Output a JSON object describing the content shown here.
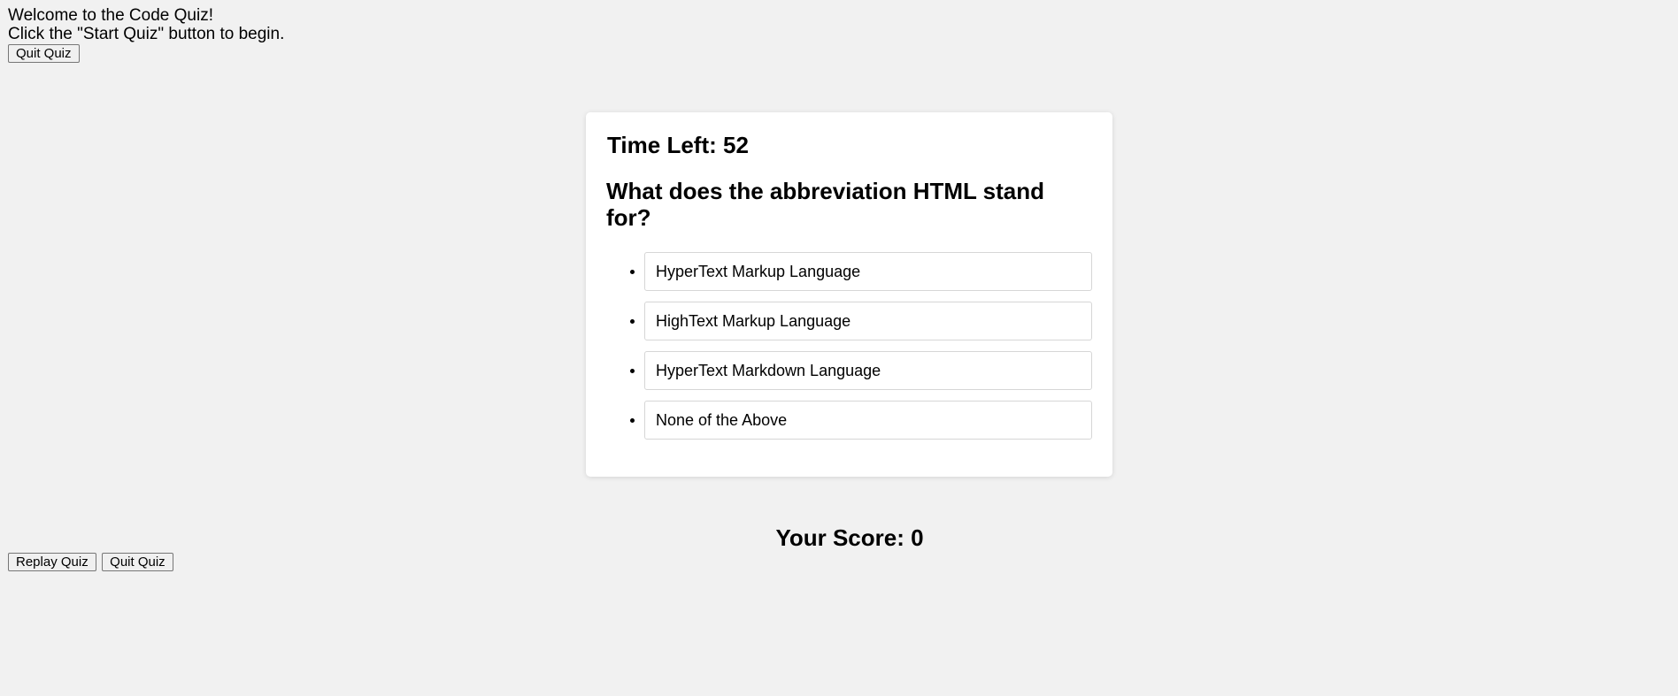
{
  "intro": {
    "welcome": "Welcome to the Code Quiz!",
    "instructions": "Click the \"Start Quiz\" button to begin.",
    "quit_label": "Quit Quiz"
  },
  "quiz": {
    "timer_text": "Time Left: 52",
    "question": "What does the abbreviation HTML stand for?",
    "choices": [
      "HyperText Markup Language",
      "HighText Markup Language",
      "HyperText Markdown Language",
      "None of the Above"
    ]
  },
  "results": {
    "score_text": "Your Score: 0",
    "replay_label": "Replay Quiz",
    "quit_label": "Quit Quiz"
  }
}
